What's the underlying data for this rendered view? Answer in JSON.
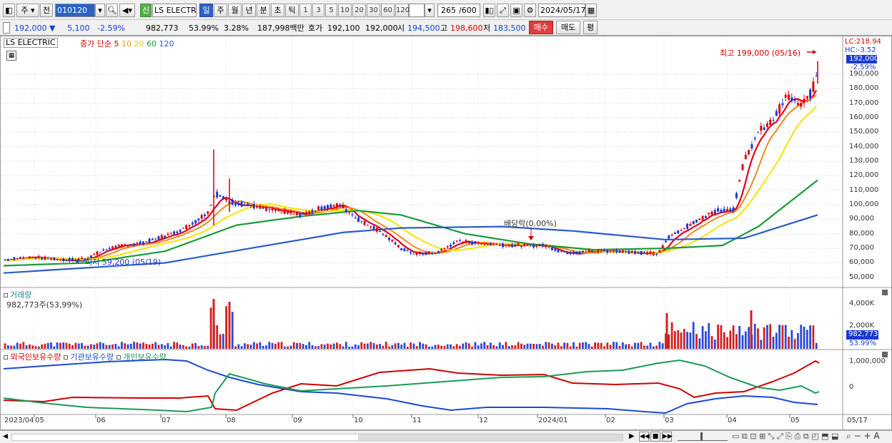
{
  "toolbar": {
    "market": "주",
    "market_btn": "전",
    "code": "010120",
    "stock_name": "LS ELECTRI",
    "new_badge": "신",
    "periods": [
      "일",
      "주",
      "월",
      "년",
      "분",
      "초",
      "틱"
    ],
    "active_period": "일",
    "intervals": [
      "1",
      "3",
      "5",
      "10",
      "20",
      "30",
      "60",
      "120"
    ],
    "count_value": "265",
    "count_max": "/600",
    "date": "2024/05/17"
  },
  "quote": {
    "price": "192,000",
    "change": "5,100",
    "change_pct": "-2.59%",
    "volume": "982,773",
    "volume_ratio": "53.99%",
    "turnover": "3.28%",
    "amount": "187,998백만",
    "bid_label": "호가",
    "bid": "192,100",
    "ask": "192,000",
    "open_label": "시",
    "open": "194,500",
    "high_label": "고",
    "high": "198,600",
    "low_label": "저",
    "low": "183,500",
    "buy_label": "매수",
    "sell_label": "매도",
    "eval_label": "평"
  },
  "price_panel": {
    "title": "LS ELECTRIC",
    "legend_prefix": "종가 단순",
    "ma": [
      {
        "period": "5",
        "color": "#e8001c"
      },
      {
        "period": "10",
        "color": "#f08a1c"
      },
      {
        "period": "20",
        "color": "#f0e000"
      },
      {
        "period": "60",
        "color": "#1a9a3a"
      },
      {
        "period": "120",
        "color": "#2a5cc8"
      }
    ],
    "lc": "LC:218.94",
    "hc": "HC:-3.52",
    "price_box": "192,000",
    "pct_tag": "-2.59%",
    "high_note": "최고 199,000 (05/16)",
    "low_note": "최저 59,200 (05/19)",
    "div_note": "배당락(0.00%)",
    "y_ticks": [
      "190,000",
      "180,000",
      "170,000",
      "160,000",
      "150,000",
      "140,000",
      "130,000",
      "120,000",
      "110,000",
      "100,000",
      "90,000",
      "80,000",
      "70,000",
      "60,000",
      "50,000"
    ]
  },
  "volume_panel": {
    "title": "거래량",
    "value_label": "982,773주(53,99%)",
    "y_ticks": [
      "4,000K",
      "2,000K"
    ],
    "box_value": "982,773",
    "box_pct": "53.99%"
  },
  "holdings_panel": {
    "legends": [
      {
        "label": "외국인보유수량",
        "color": "#d00000"
      },
      {
        "label": "기관보유수량",
        "color": "#1a4ad0"
      },
      {
        "label": "개인보유수량",
        "color": "#1a9a5a"
      }
    ],
    "y_ticks": [
      "1,000,000",
      "0"
    ]
  },
  "x_axis": {
    "labels": [
      "2023/04",
      "05",
      "06",
      "07",
      "08",
      "09",
      "10",
      "11",
      "12",
      "2024/01",
      "02",
      "03",
      "04",
      "05",
      "05/17"
    ]
  },
  "chart_data": {
    "type": "candlestick",
    "title": "LS ELECTRIC",
    "y_unit": "KRW",
    "ylim": [
      45000,
      215000
    ],
    "close_approx": [
      {
        "x": "2023/04",
        "y": 62000
      },
      {
        "x": "05",
        "y": 63000
      },
      {
        "x": "06",
        "y": 72000
      },
      {
        "x": "07",
        "y": 82000
      },
      {
        "x": "08",
        "y": 100000
      },
      {
        "x": "09",
        "y": 95000
      },
      {
        "x": "10",
        "y": 97000
      },
      {
        "x": "11",
        "y": 65000
      },
      {
        "x": "12",
        "y": 75000
      },
      {
        "x": "2024/01",
        "y": 72000
      },
      {
        "x": "02",
        "y": 67000
      },
      {
        "x": "03",
        "y": 70000
      },
      {
        "x": "04",
        "y": 100000
      },
      {
        "x": "05",
        "y": 170000
      },
      {
        "x": "05/17",
        "y": 192000
      }
    ],
    "ma120_approx": [
      {
        "x": "2023/04",
        "y": 53000
      },
      {
        "x": "07",
        "y": 60000
      },
      {
        "x": "10",
        "y": 82000
      },
      {
        "x": "12",
        "y": 85000
      },
      {
        "x": "03",
        "y": 76000
      },
      {
        "x": "05/17",
        "y": 93000
      }
    ],
    "grid": true
  }
}
